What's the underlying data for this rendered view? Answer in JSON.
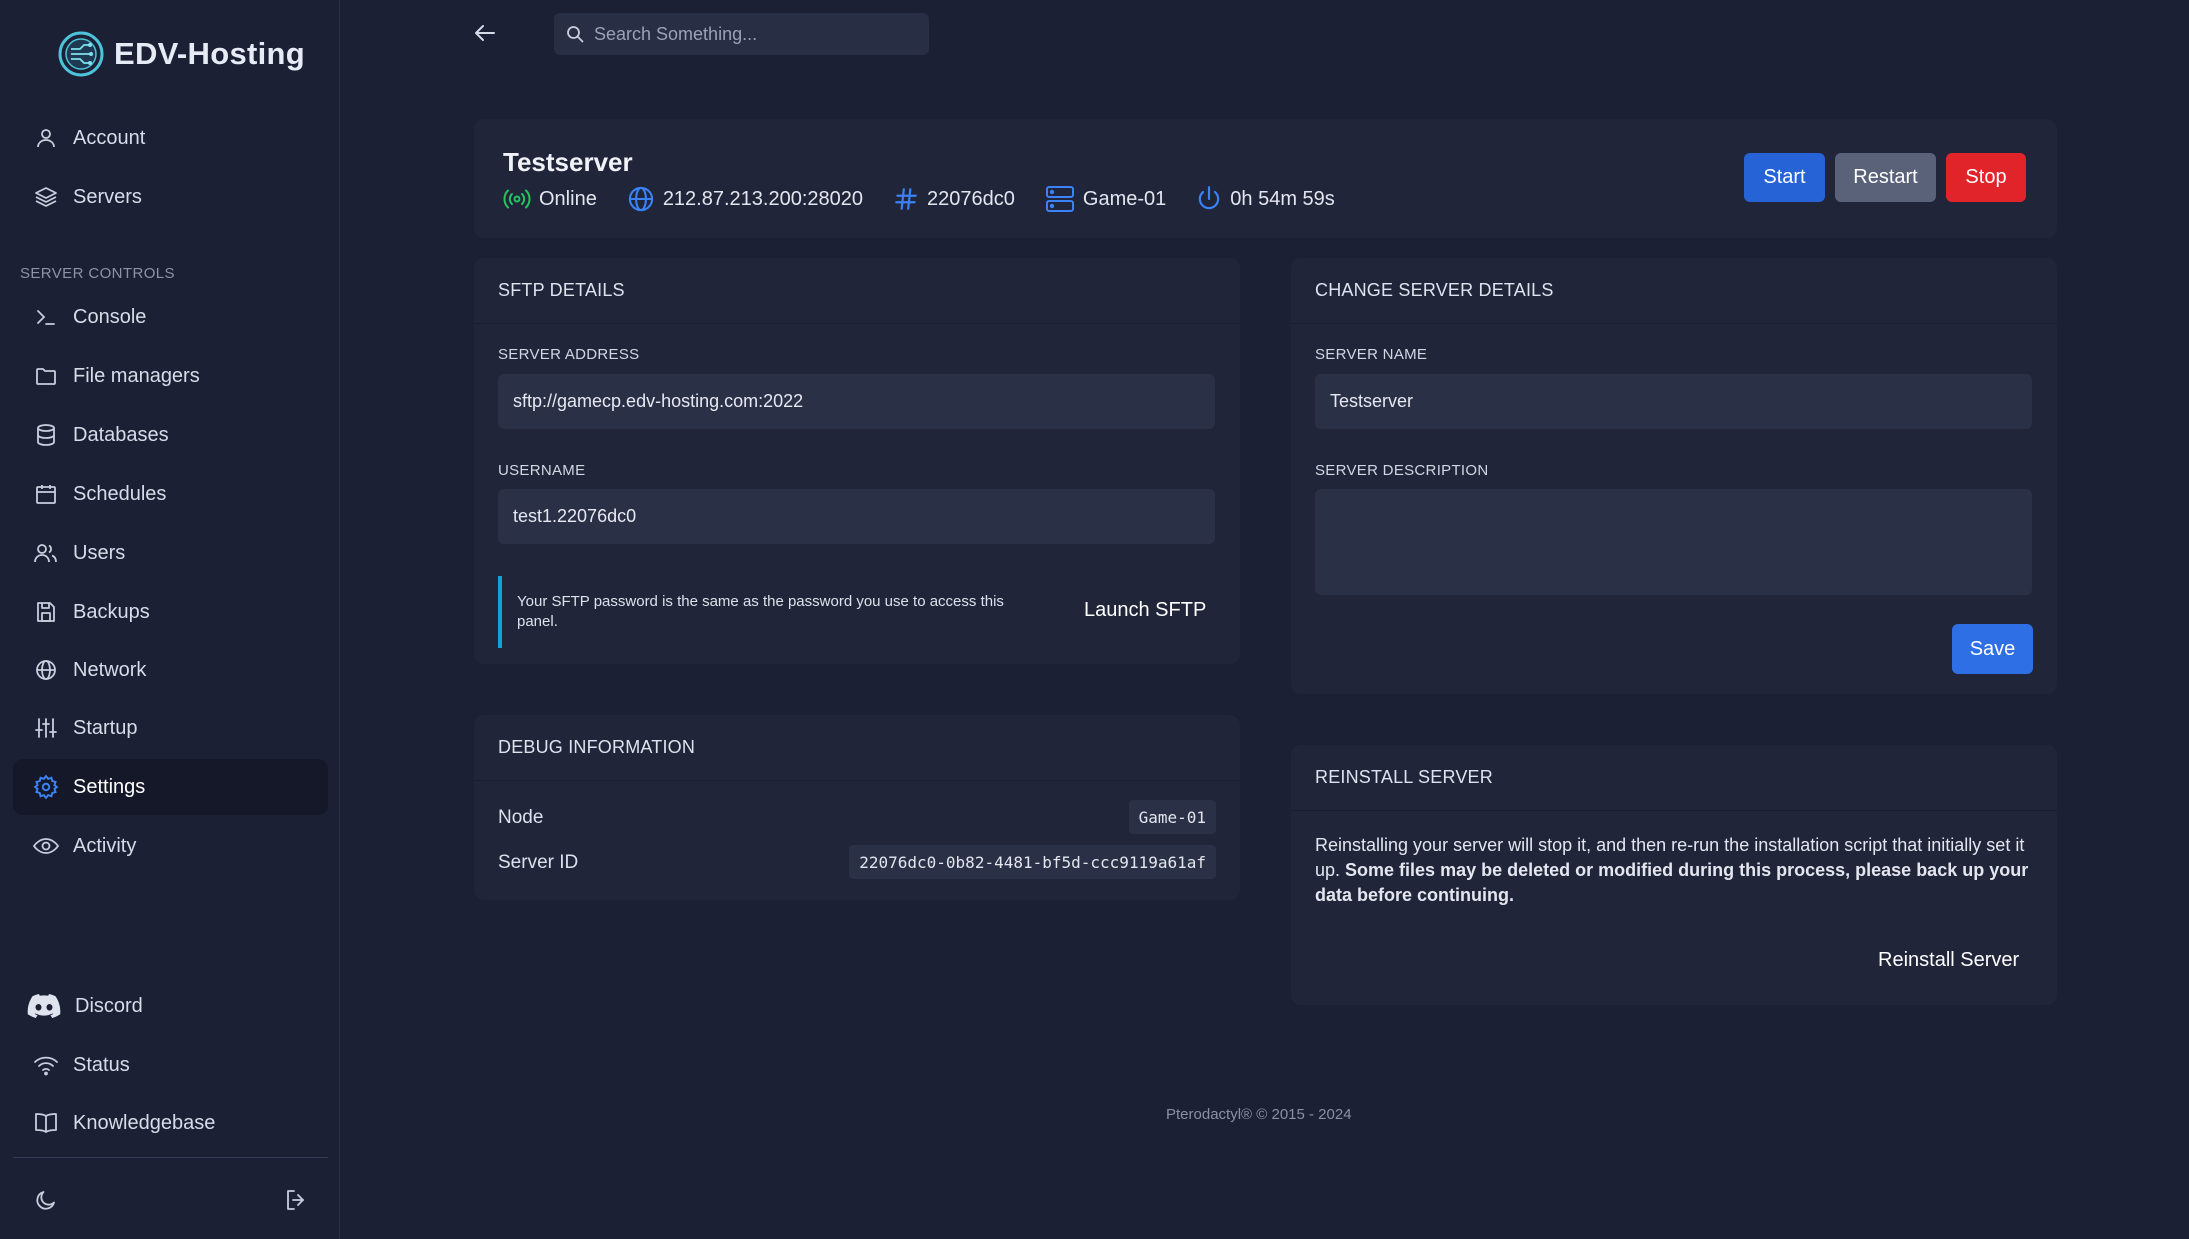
{
  "brand": {
    "name": "EDV-Hosting"
  },
  "sidebar": {
    "top_items": [
      {
        "label": "Account",
        "icon": "user-icon"
      },
      {
        "label": "Servers",
        "icon": "layers-icon"
      }
    ],
    "section_title": "SERVER CONTROLS",
    "control_items": [
      {
        "label": "Console",
        "icon": "terminal-icon"
      },
      {
        "label": "File managers",
        "icon": "folder-icon"
      },
      {
        "label": "Databases",
        "icon": "database-icon"
      },
      {
        "label": "Schedules",
        "icon": "calendar-icon"
      },
      {
        "label": "Users",
        "icon": "users-icon"
      },
      {
        "label": "Backups",
        "icon": "save-icon"
      },
      {
        "label": "Network",
        "icon": "globe-icon"
      },
      {
        "label": "Startup",
        "icon": "sliders-icon"
      },
      {
        "label": "Settings",
        "icon": "gear-icon",
        "active": true
      },
      {
        "label": "Activity",
        "icon": "eye-icon"
      }
    ],
    "bottom_items": [
      {
        "label": "Discord",
        "icon": "discord-icon"
      },
      {
        "label": "Status",
        "icon": "wifi-icon"
      },
      {
        "label": "Knowledgebase",
        "icon": "book-icon"
      }
    ]
  },
  "topbar": {
    "search_placeholder": "Search Something..."
  },
  "server": {
    "name": "Testserver",
    "status": "Online",
    "address": "212.87.213.200:28020",
    "id_short": "22076dc0",
    "node": "Game-01",
    "uptime": "0h 54m 59s",
    "buttons": {
      "start": "Start",
      "restart": "Restart",
      "stop": "Stop"
    }
  },
  "sftp": {
    "title": "SFTP DETAILS",
    "address_label": "SERVER ADDRESS",
    "address_value": "sftp://gamecp.edv-hosting.com:2022",
    "username_label": "USERNAME",
    "username_value": "test1.22076dc0",
    "notice": "Your SFTP password is the same as the password you use to access this panel.",
    "launch_label": "Launch SFTP"
  },
  "debug": {
    "title": "DEBUG INFORMATION",
    "node_label": "Node",
    "node_value": "Game-01",
    "server_id_label": "Server ID",
    "server_id_value": "22076dc0-0b82-4481-bf5d-ccc9119a61af"
  },
  "change_details": {
    "title": "CHANGE SERVER DETAILS",
    "name_label": "SERVER NAME",
    "name_value": "Testserver",
    "description_label": "SERVER DESCRIPTION",
    "description_value": "",
    "save_label": "Save"
  },
  "reinstall": {
    "title": "REINSTALL SERVER",
    "text_normal": "Reinstalling your server will stop it, and then re-run the installation script that initially set it up. ",
    "text_bold": "Some files may be deleted or modified during this process, please back up your data before continuing.",
    "button_label": "Reinstall Server"
  },
  "footer": {
    "text": "Pterodactyl® © 2015 - 2024"
  },
  "colors": {
    "background": "#1b2035",
    "card": "#202539",
    "input": "#2a3046",
    "primary_blue": "#2563d6",
    "gray_button": "#5a627a",
    "danger_red": "#e0242a",
    "online_green": "#22c55e",
    "accent_blue": "#3b82f6",
    "notice_cyan": "#12a3d6"
  }
}
